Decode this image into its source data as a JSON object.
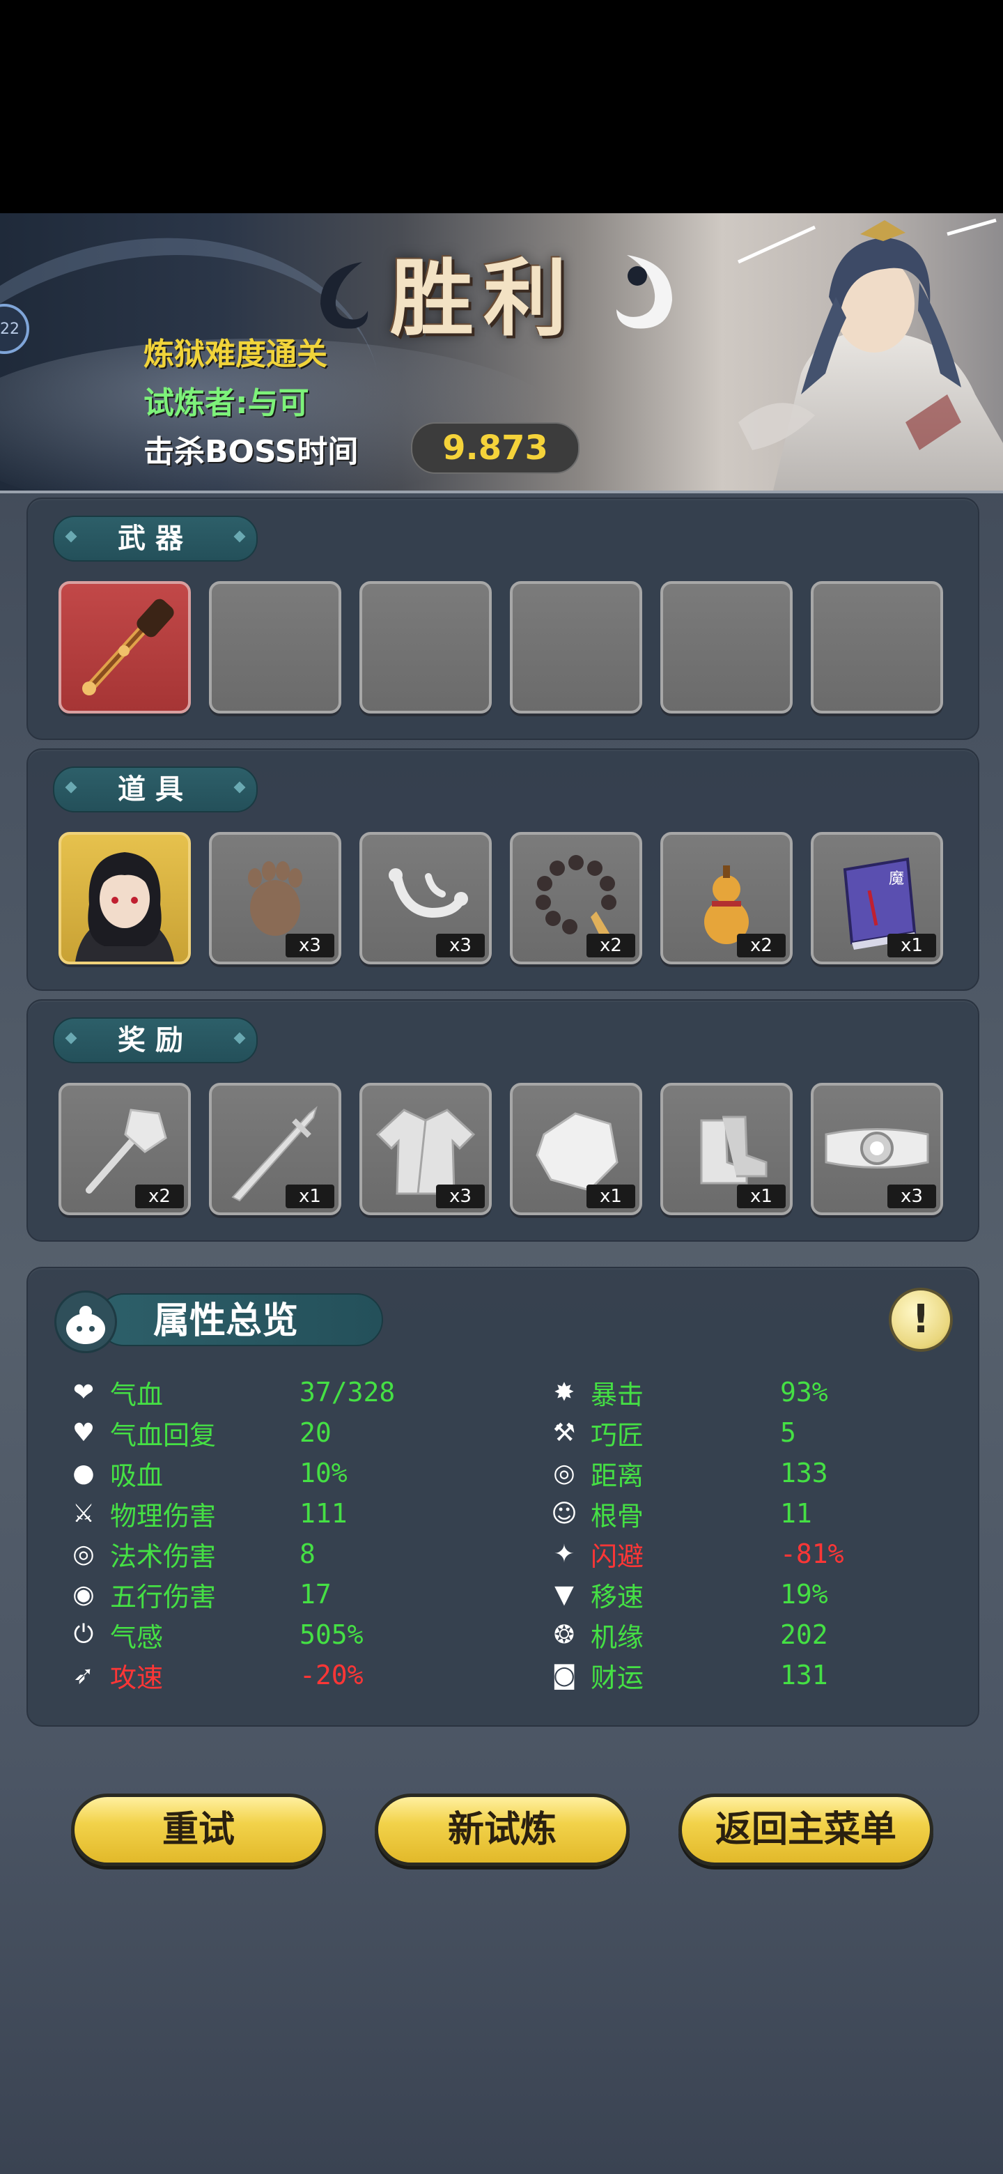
{
  "banner": {
    "title": "胜利",
    "difficulty": "炼狱难度通关",
    "challenger": "试炼者:与可",
    "boss_label": "击杀BOSS时间",
    "boss_time": "9.873",
    "badge": "22"
  },
  "weapons": {
    "label": "武器",
    "slots": [
      {
        "item": "staff-icon",
        "count": ""
      },
      {
        "item": "",
        "count": ""
      },
      {
        "item": "",
        "count": ""
      },
      {
        "item": "",
        "count": ""
      },
      {
        "item": "",
        "count": ""
      },
      {
        "item": "",
        "count": ""
      }
    ]
  },
  "items": {
    "label": "道具",
    "slots": [
      {
        "item": "character-portrait-icon",
        "count": ""
      },
      {
        "item": "paw-icon",
        "count": "x3"
      },
      {
        "item": "bone-icon",
        "count": "x3"
      },
      {
        "item": "prayer-beads-icon",
        "count": "x2"
      },
      {
        "item": "gourd-icon",
        "count": "x2"
      },
      {
        "item": "demon-book-icon",
        "count": "x1"
      }
    ]
  },
  "rewards": {
    "label": "奖励",
    "slots": [
      {
        "item": "mace-icon",
        "count": "x2"
      },
      {
        "item": "sword-icon",
        "count": "x1"
      },
      {
        "item": "robe-icon",
        "count": "x3"
      },
      {
        "item": "stone-icon",
        "count": "x1"
      },
      {
        "item": "boots-icon",
        "count": "x1"
      },
      {
        "item": "belt-icon",
        "count": "x3"
      }
    ]
  },
  "attributes": {
    "title": "属性总览",
    "left": [
      {
        "icon": "heart-icon",
        "name": "气血",
        "value": "37/328",
        "color": "green"
      },
      {
        "icon": "heart-regen-icon",
        "name": "气血回复",
        "value": "20",
        "color": "green"
      },
      {
        "icon": "drop-icon",
        "name": "吸血",
        "value": "10%",
        "color": "green"
      },
      {
        "icon": "blade-icon",
        "name": "物理伤害",
        "value": "111",
        "color": "green"
      },
      {
        "icon": "swirl-icon",
        "name": "法术伤害",
        "value": "8",
        "color": "green"
      },
      {
        "icon": "rings-icon",
        "name": "五行伤害",
        "value": "17",
        "color": "green"
      },
      {
        "icon": "power-icon",
        "name": "气感",
        "value": "505%",
        "color": "green"
      },
      {
        "icon": "speed-icon",
        "name": "攻速",
        "value": "-20%",
        "color": "red"
      }
    ],
    "right": [
      {
        "icon": "crit-icon",
        "name": "暴击",
        "value": "93%",
        "color": "green"
      },
      {
        "icon": "hammer-icon",
        "name": "巧匠",
        "value": "5",
        "color": "green"
      },
      {
        "icon": "target-icon",
        "name": "距离",
        "value": "133",
        "color": "green"
      },
      {
        "icon": "person-icon",
        "name": "根骨",
        "value": "11",
        "color": "green"
      },
      {
        "icon": "dodge-icon",
        "name": "闪避",
        "value": "-81%",
        "color": "red"
      },
      {
        "icon": "boot-icon",
        "name": "移速",
        "value": "19%",
        "color": "green"
      },
      {
        "icon": "fortune-icon",
        "name": "机缘",
        "value": "202",
        "color": "green"
      },
      {
        "icon": "coin-icon",
        "name": "财运",
        "value": "131",
        "color": "green"
      }
    ]
  },
  "buttons": {
    "retry": "重试",
    "new_trial": "新试炼",
    "main_menu": "返回主菜单"
  },
  "colors": {
    "green": "#45e044",
    "red": "#ff3636",
    "gold": "#f2d24a"
  }
}
